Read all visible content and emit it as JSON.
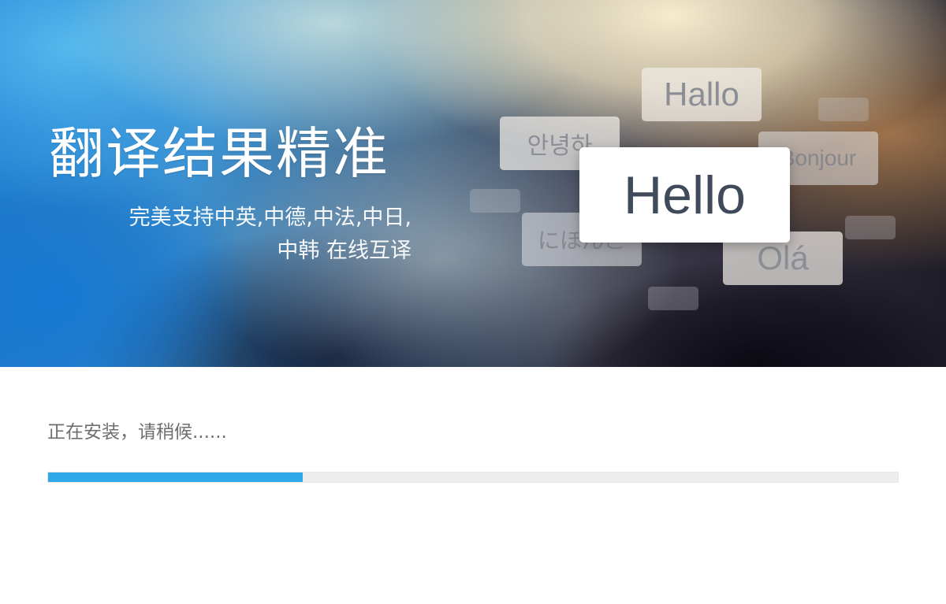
{
  "banner": {
    "title": "翻译结果精准",
    "subtitle_line1": "完美支持中英,中德,中法,中日,",
    "subtitle_line2": "中韩 在线互译",
    "cards": {
      "hallo": "Hallo",
      "korean": "안녕하",
      "bonjour": "Bonjour",
      "hello": "Hello",
      "japanese": "にほんご",
      "ola": "Olá"
    }
  },
  "install": {
    "status_text": "正在安装，请稍候......",
    "progress": 0.3
  },
  "colors": {
    "progress_fill": "#2fa8e9",
    "progress_track": "#ededed",
    "status_text": "#6e6e6e"
  }
}
